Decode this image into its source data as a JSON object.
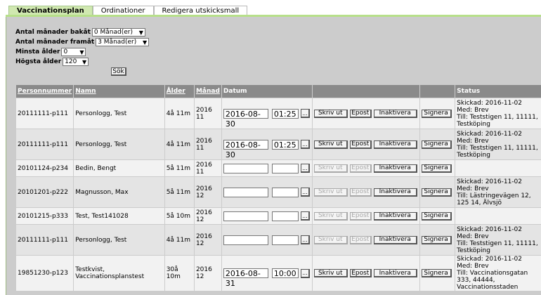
{
  "tabs": [
    {
      "label": "Vaccinationsplan",
      "active": true
    },
    {
      "label": "Ordinationer",
      "active": false
    },
    {
      "label": "Redigera utskicksmall",
      "active": false
    }
  ],
  "filters": {
    "months_back_label": "Antal månader bakåt",
    "months_back_value": "0 Månad(er)",
    "months_forward_label": "Antal månader framåt",
    "months_forward_value": "3 Månad(er)",
    "min_age_label": "Minsta ålder",
    "min_age_value": "0",
    "max_age_label": "Högsta ålder",
    "max_age_value": "120",
    "search_label": "Sök"
  },
  "table": {
    "headers": {
      "pnr": "Personnummer",
      "name": "Namn",
      "age": "Ålder",
      "month": "Månad",
      "date": "Datum",
      "status": "Status"
    },
    "buttons": {
      "print": "Skriv ut",
      "email": "Epost",
      "deactivate": "Inaktivera",
      "sign": "Signera",
      "picker": "..."
    },
    "rows": [
      {
        "pnr": "20111111-p111",
        "name": "Personlogg, Test",
        "age": "4å 11m",
        "month": "2016 11",
        "date": "2016-08-30",
        "time": "01:25",
        "status": [
          "Skickad: 2016-11-02",
          "Med: Brev",
          "Till: Teststigen 11, 11111, Testköping"
        ]
      },
      {
        "pnr": "20111111-p111",
        "name": "Personlogg, Test",
        "age": "4å 11m",
        "month": "2016 11",
        "date": "2016-08-30",
        "time": "01:25",
        "status": [
          "Skickad: 2016-11-02",
          "Med: Brev",
          "Till: Teststigen 11, 11111, Testköping"
        ]
      },
      {
        "pnr": "20101124-p234",
        "name": "Bedin, Bengt",
        "age": "5å 11m",
        "month": "2016 11",
        "date": "",
        "time": "",
        "status": []
      },
      {
        "pnr": "20101201-p222",
        "name": "Magnusson, Max",
        "age": "5å 11m",
        "month": "2016 12",
        "date": "",
        "time": "",
        "status": [
          "Skickad: 2016-11-02",
          "Med: Brev",
          "Till: Lästringevägen 12, 125 14, Älvsjö"
        ]
      },
      {
        "pnr": "20101215-p333",
        "name": "Test, Test141028",
        "age": "5å 10m",
        "month": "2016 12",
        "date": "",
        "time": "",
        "status": []
      },
      {
        "pnr": "20111111-p111",
        "name": "Personlogg, Test",
        "age": "4å 11m",
        "month": "2016 12",
        "date": "",
        "time": "",
        "status": [
          "Skickad: 2016-11-02",
          "Med: Brev",
          "Till: Teststigen 11, 11111, Testköping"
        ]
      },
      {
        "pnr": "19851230-p123",
        "name": "Testkvist, Vaccinationsplanstest",
        "age": "30å 10m",
        "month": "2016 12",
        "date": "2016-08-31",
        "time": "10:00",
        "status": [
          "Skickad: 2016-11-02",
          "Med: Brev",
          "Till: Vaccinationsgatan 333, 44444, Vaccinationsstaden"
        ]
      }
    ]
  }
}
